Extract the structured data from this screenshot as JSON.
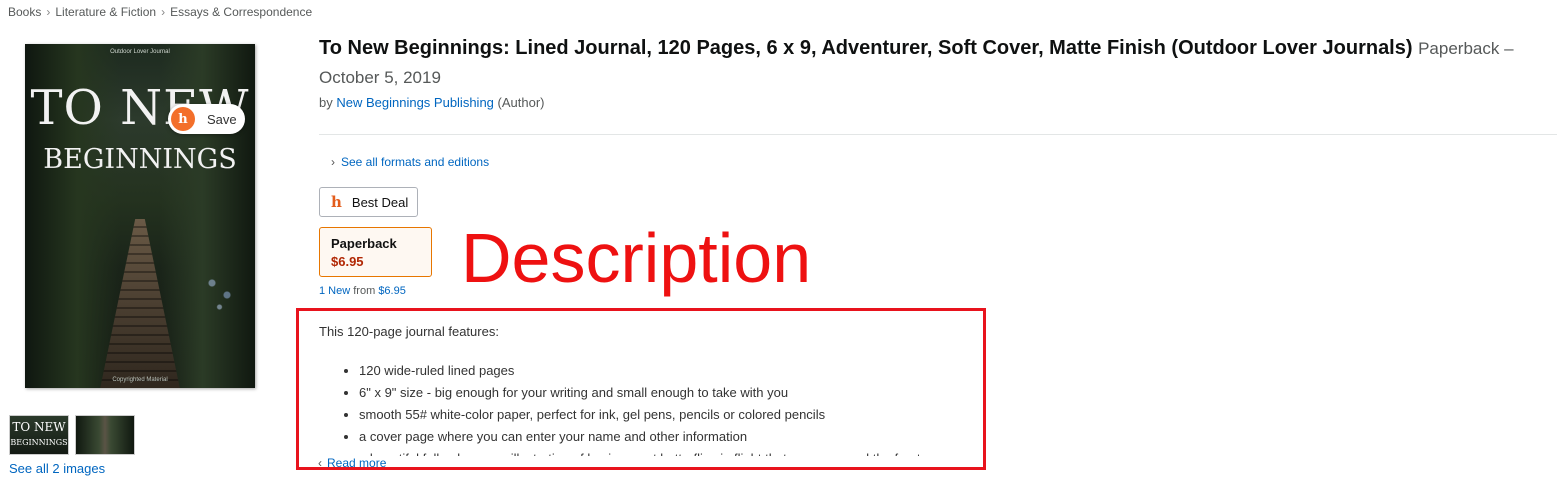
{
  "breadcrumb": [
    "Books",
    "Literature & Fiction",
    "Essays & Correspondence"
  ],
  "cover": {
    "top_text": "Outdoor Lover Journal",
    "title_line1": "TO NEW",
    "title_line2": "BEGINNINGS",
    "bottom_text": "Copyrighted Material"
  },
  "save_button": {
    "icon_glyph": "h",
    "label": "Save"
  },
  "thumbnails": {
    "thumb1_line1": "TO NEW",
    "thumb1_line2": "BEGINNINGS",
    "see_all": "See all 2 images"
  },
  "product": {
    "title": "To New Beginnings: Lined Journal, 120 Pages, 6 x 9, Adventurer, Soft Cover, Matte Finish (Outdoor Lover Journals)",
    "format_date": "Paperback – October 5, 2019",
    "by_prefix": "by",
    "author": "New Beginnings Publishing",
    "author_role": "(Author)"
  },
  "formats_link": "See all formats and editions",
  "best_deal": {
    "icon_glyph": "h",
    "label": "Best Deal"
  },
  "format_option": {
    "name": "Paperback",
    "price": "$6.95"
  },
  "new_from": {
    "count": "1 New",
    "text": "from",
    "price": "$6.95"
  },
  "annotation": {
    "label": "Description",
    "color": "#e8131d"
  },
  "description": {
    "intro": "This 120-page journal features:",
    "bullets": [
      "120 wide-ruled lined pages",
      "6\" x 9\" size - big enough for your writing and small enough to take with you",
      "smooth 55# white-color paper, perfect for ink, gel pens, pencils or colored pencils",
      "a cover page where you can enter your name and other information",
      "a beautiful full-color cover illustration of luminescent butterflies in flight that wraps around the front"
    ],
    "read_more": "Read more"
  },
  "colors": {
    "link": "#0066c0",
    "price": "#b12704",
    "format_border": "#e77600",
    "brand_orange": "#f36f2a"
  }
}
